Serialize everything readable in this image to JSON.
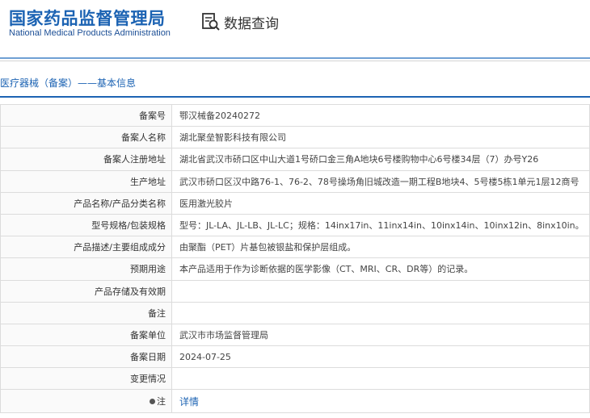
{
  "header": {
    "org_name_cn": "国家药品监督管理局",
    "org_name_en": "National Medical Products Administration",
    "query_label": "数据查询"
  },
  "section": {
    "title": "医疗器械（备案）——基本信息"
  },
  "rows": [
    {
      "label": "备案号",
      "value": "鄂汉械备20240272"
    },
    {
      "label": "备案人名称",
      "value": "湖北聚垒智影科技有限公司"
    },
    {
      "label": "备案人注册地址",
      "value": "湖北省武汉市硚口区中山大道1号硚口金三角A地块6号楼购物中心6号楼34层（7）办号Y26"
    },
    {
      "label": "生产地址",
      "value": "武汉市硚口区汉中路76-1、76-2、78号操场角旧城改造一期工程B地块4、5号楼5栋1单元1层12商号"
    },
    {
      "label": "产品名称/产品分类名称",
      "value": "医用激光胶片"
    },
    {
      "label": "型号规格/包装规格",
      "value": "型号：JL-LA、JL-LB、JL-LC；规格：14inx17in、11inx14in、10inx14in、10inx12in、8inx10in。"
    },
    {
      "label": "产品描述/主要组成成分",
      "value": "由聚酯（PET）片基包被银盐和保护层组成。"
    },
    {
      "label": "预期用途",
      "value": "本产品适用于作为诊断依据的医学影像（CT、MRI、CR、DR等）的记录。"
    },
    {
      "label": "产品存储及有效期",
      "value": ""
    },
    {
      "label": "备注",
      "value": ""
    },
    {
      "label": "备案单位",
      "value": "武汉市市场监督管理局"
    },
    {
      "label": "备案日期",
      "value": "2024-07-25"
    },
    {
      "label": "变更情况",
      "value": ""
    }
  ],
  "note_row": {
    "label": "注",
    "link_text": "详情"
  },
  "colors": {
    "brand_blue": "#1c63b3",
    "divider_blue": "#6fa0d4"
  },
  "icons": {
    "query": "document-search-icon",
    "note": "dot-icon"
  }
}
